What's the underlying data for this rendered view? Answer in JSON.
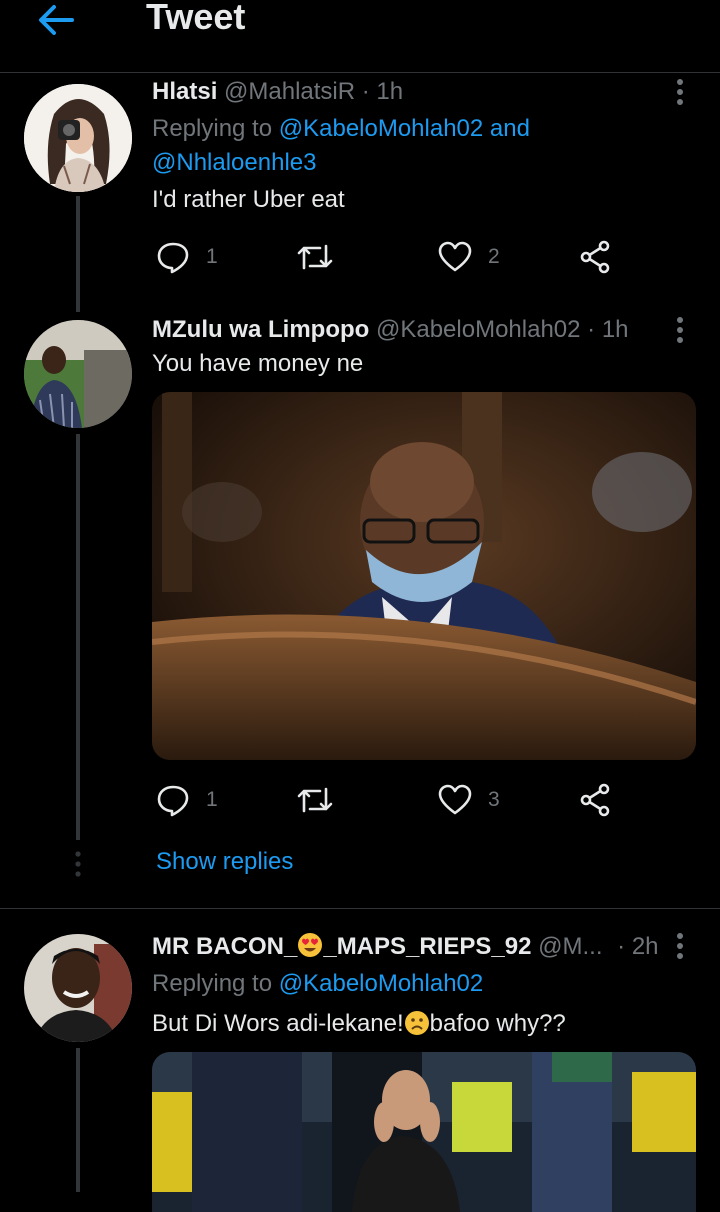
{
  "header": {
    "title": "Tweet",
    "back_icon": "arrow-left-icon",
    "accent": "#1d9bf0"
  },
  "tweets": [
    {
      "name": "Hlatsi",
      "handle": "@MahlatsiR",
      "time": "· 1h",
      "replying_prefix": "Replying to ",
      "replying_1": "@KabeloMohlah02",
      "replying_and": " and",
      "replying_2": "@Nhlaloenhle3",
      "text": "I'd rather Uber eat",
      "replies": "1",
      "likes": "2"
    },
    {
      "name": "MZulu wa Limpopo",
      "handle": "@KabeloMohlah02",
      "time": "· 1h",
      "text": "You have money ne",
      "replies": "1",
      "likes": "3",
      "show_replies": "Show replies"
    },
    {
      "name_a": "MR BACON_",
      "name_b": "_MAPS_RIEPS_92",
      "handle": "@M...",
      "time": "· 2h",
      "replying_prefix": "Replying to ",
      "replying_1": "@KabeloMohlah02",
      "text_a": "But Di Wors adi-lekane!",
      "text_b": "bafoo why??"
    }
  ]
}
